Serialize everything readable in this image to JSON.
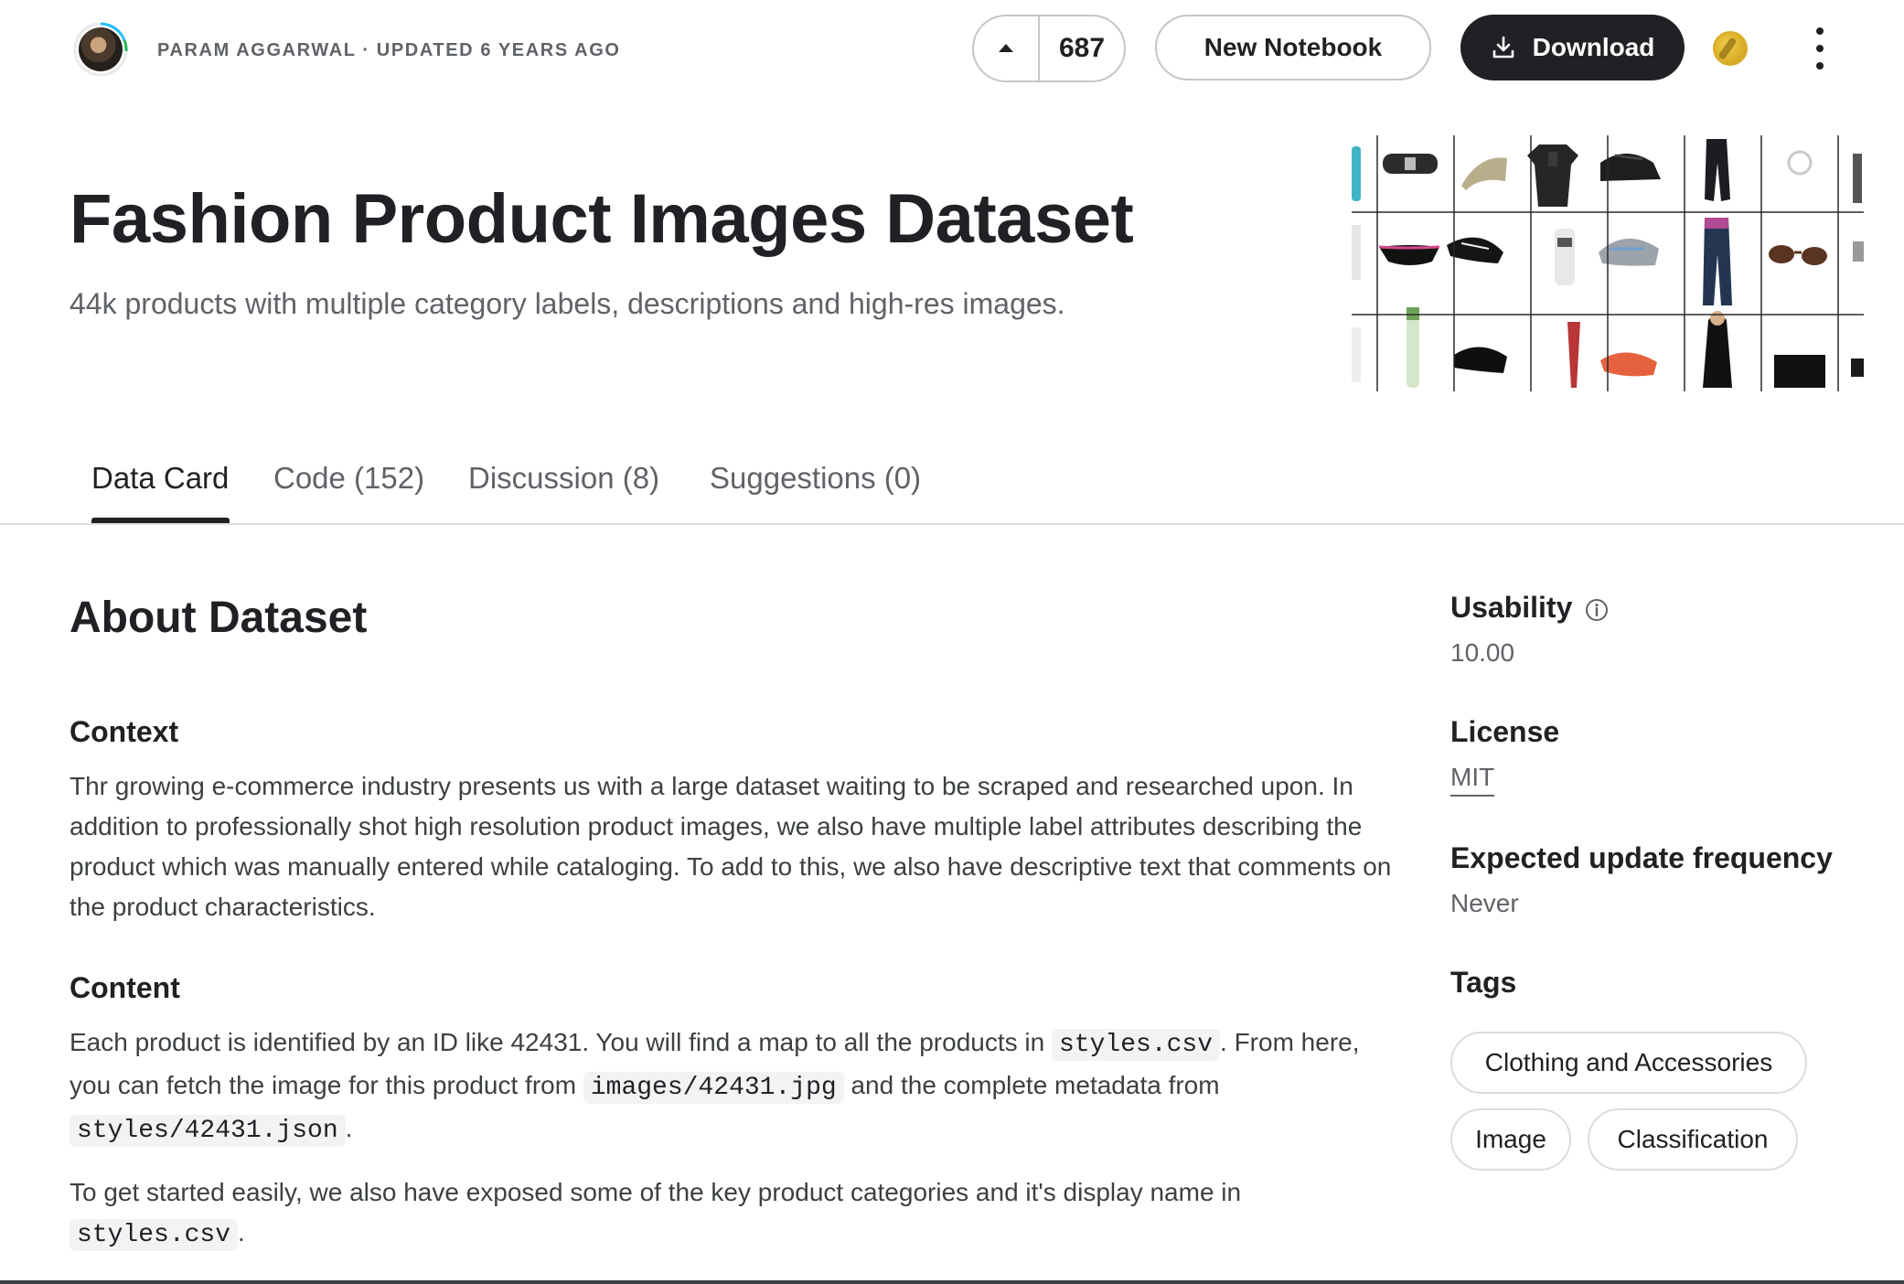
{
  "header": {
    "byline": "Param Aggarwal · Updated 6 years ago",
    "vote_count": "687",
    "new_notebook_label": "New Notebook",
    "download_label": "Download"
  },
  "hero": {
    "title": "Fashion Product Images Dataset",
    "subtitle": "44k products with multiple category labels, descriptions and high-res images."
  },
  "tabs": [
    {
      "label": "Data Card",
      "active": true
    },
    {
      "label": "Code (152)",
      "active": false
    },
    {
      "label": "Discussion (8)",
      "active": false
    },
    {
      "label": "Suggestions (0)",
      "active": false
    }
  ],
  "main": {
    "about_heading": "About Dataset",
    "context_heading": "Context",
    "context_text": "Thr growing e-commerce industry presents us with a large dataset waiting to be scraped and researched upon. In addition to professionally shot high resolution product images, we also have multiple label attributes describing the product which was manually entered while cataloging. To add to this, we also have descriptive text that comments on the product characteristics.",
    "content_heading": "Content",
    "content_p1_a": "Each product is identified by an ID like 42431. You will find a map to all the products in ",
    "content_p1_code1": "styles.csv",
    "content_p1_b": ". From here, you can fetch the image for this product from ",
    "content_p1_code2": "images/42431.jpg",
    "content_p1_c": " and the complete metadata from ",
    "content_p1_code3": "styles/42431.json",
    "content_p1_d": ".",
    "content_p2_a": "To get started easily, we also have exposed some of the key product categories and it's display name in ",
    "content_p2_code": "styles.csv",
    "content_p2_b": "."
  },
  "sidebar": {
    "usability_label": "Usability",
    "usability_value": "10.00",
    "license_label": "License",
    "license_value": "MIT",
    "frequency_label": "Expected update frequency",
    "frequency_value": "Never",
    "tags_label": "Tags",
    "tags": [
      "Clothing and Accessories",
      "Image",
      "Classification"
    ]
  },
  "colors": {
    "text_primary": "#202124",
    "text_secondary": "#5f6368",
    "border": "#dadce0",
    "button_dark": "#202124",
    "medal_gold": "#e2b42a"
  },
  "icons": [
    "avatar",
    "upvote-arrow-icon",
    "download-icon",
    "medal-icon",
    "kebab-menu-icon",
    "info-icon"
  ]
}
